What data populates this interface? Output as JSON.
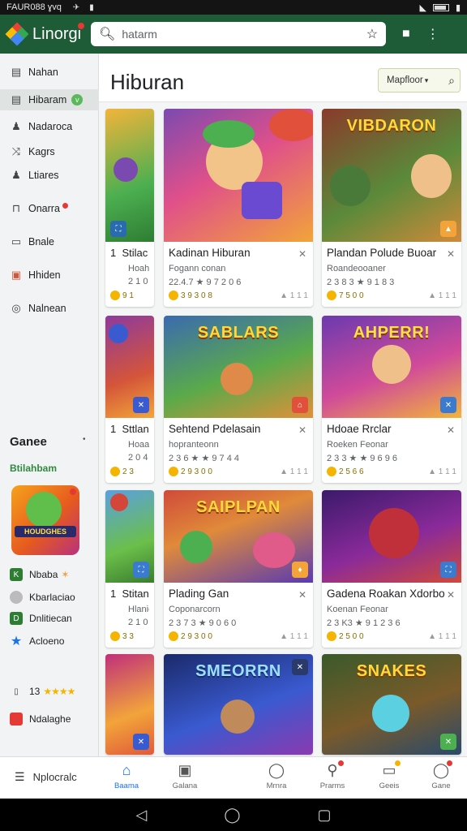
{
  "status": {
    "time": "FAUR088 ɣvq"
  },
  "app": {
    "title": "Linorgi",
    "search_placeholder": "hatarm"
  },
  "sidebar": {
    "items": [
      {
        "label": "Nahan",
        "icon": "book-icon"
      },
      {
        "label": "Hibaram",
        "icon": "list-icon",
        "tag": "v"
      },
      {
        "label": "Nadaroca",
        "icon": "people-icon"
      },
      {
        "label": "Kagrs",
        "icon": "shuffle-icon"
      },
      {
        "label": "Ltiares",
        "icon": "people-icon"
      },
      {
        "label": "Onarra",
        "icon": "arch-icon"
      },
      {
        "label": "Bnale",
        "icon": "doc-icon"
      },
      {
        "label": "Hhiden",
        "icon": "gift-icon"
      },
      {
        "label": "Nalnean",
        "icon": "search-icon"
      }
    ],
    "games_heading": "Ganee",
    "games_sub": "Btilahbam",
    "featured_caption": "HOUDGHES",
    "mini_items": [
      {
        "label": "Nbaba",
        "icon": "k-icon"
      },
      {
        "label": "Kbarlaciao",
        "icon": "cloud-icon"
      },
      {
        "label": "Dnlitiecan",
        "icon": "d-icon"
      },
      {
        "label": "Acloeno",
        "icon": "star-icon"
      }
    ],
    "rating_label": "13",
    "rating_stars": "★★★★",
    "last_item": "Ndalaghe"
  },
  "main": {
    "title": "Hiburan",
    "filter_label": "Mapfloor"
  },
  "cards": [
    {
      "title": "Kadinan Hiburan",
      "sub": "Fogann conan",
      "meta": "22.4.7 ★ 9 7 2 0 6",
      "price": "3 9 3 0 8",
      "likes": "▲ 1 1 1",
      "banner": ""
    },
    {
      "title": "Plandan Polude Buoar",
      "sub": "Roandeooaner",
      "meta": "2 3 8 3 ★ 9 1 8 3",
      "price": "7 5 0 0",
      "likes": "▲ 1 1 1",
      "banner": "VIBDARON"
    },
    {
      "title": "Sehtend Pdelasain",
      "sub": "hopranteonn",
      "meta": "2 3 6 ★ ★ 9 7 4 4",
      "price": "2 9 3 0 0",
      "likes": "▲ 1 1 1",
      "banner": "SABLARS"
    },
    {
      "title": "Hdoae Rrclar",
      "sub": "Roeken Feonar",
      "meta": "2 3 3 ★ ★ 9 6 9 6",
      "price": "2 5 6 6",
      "likes": "▲ 1 1 1",
      "banner": "AHPERR!"
    },
    {
      "title": "Plading Gan",
      "sub": "Coponarcorn",
      "meta": "2 3 7 3 ★ 9 0 6 0",
      "price": "2 9 3 0 0",
      "likes": "▲ 1 1 1",
      "banner": "SAIPLPAN"
    },
    {
      "title": "Gadena Roakan Xdorbo",
      "sub": "Koenan Feonar",
      "meta": "2 3 K3 ★ 9 1 2 3 6",
      "price": "2 5 0 0",
      "likes": "▲ 1 1 1",
      "banner": ""
    },
    {
      "title": "",
      "sub": "",
      "meta": "",
      "price": "",
      "likes": "",
      "banner": "SMEORRN"
    },
    {
      "title": "",
      "sub": "",
      "meta": "",
      "price": "",
      "likes": "",
      "banner": "SNAKES"
    }
  ],
  "narrow_cards": [
    {
      "num": "1",
      "title": "Stilac",
      "sub": "Hoaha",
      "meta": "2 1 0",
      "price": "9 1"
    },
    {
      "num": "1",
      "title": "Sttlan",
      "sub": "Hoaao",
      "meta": "2 0 4",
      "price": "2 3"
    },
    {
      "num": "1",
      "title": "Stitan",
      "sub": "Hlanio",
      "meta": "2 1 0",
      "price": "3 3"
    },
    {
      "num": "",
      "title": "",
      "sub": "",
      "meta": "",
      "price": ""
    }
  ],
  "bottom_nav": {
    "left_label": "Nplocralc",
    "items": [
      "Baama",
      "Galana",
      "Mrnra",
      "Prarms",
      "Geeis",
      "Gane"
    ]
  }
}
